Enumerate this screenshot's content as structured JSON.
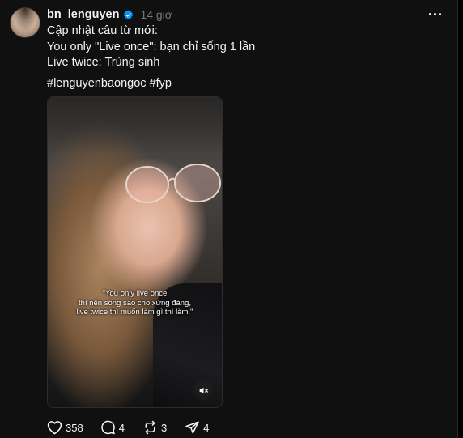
{
  "post": {
    "username": "bn_lenguyen",
    "time": "14 giờ",
    "caption_lines": [
      "Cập nhật câu từ mới:",
      "You only \"Live once\": bạn chỉ sống 1 lần",
      "Live twice: Trùng sinh"
    ],
    "hashtags": "#lenguyenbaongoc #fyp"
  },
  "video": {
    "subtitle_lines": [
      "\"You only live once",
      "thì nên sống sao cho xứng đáng,",
      "live twice thì muốn làm gì thì làm.\""
    ]
  },
  "actions": {
    "likes": "358",
    "comments": "4",
    "reposts": "3",
    "shares": "4"
  },
  "icons": {
    "verified": "verified-badge-icon",
    "more": "more-options-icon",
    "mute": "volume-muted-icon",
    "like": "heart-icon",
    "comment": "comment-icon",
    "repost": "repost-icon",
    "share": "send-icon"
  },
  "colors": {
    "background": "#101010",
    "text": "#f3f5f7",
    "muted_text": "#777777",
    "verified": "#0095f6"
  }
}
